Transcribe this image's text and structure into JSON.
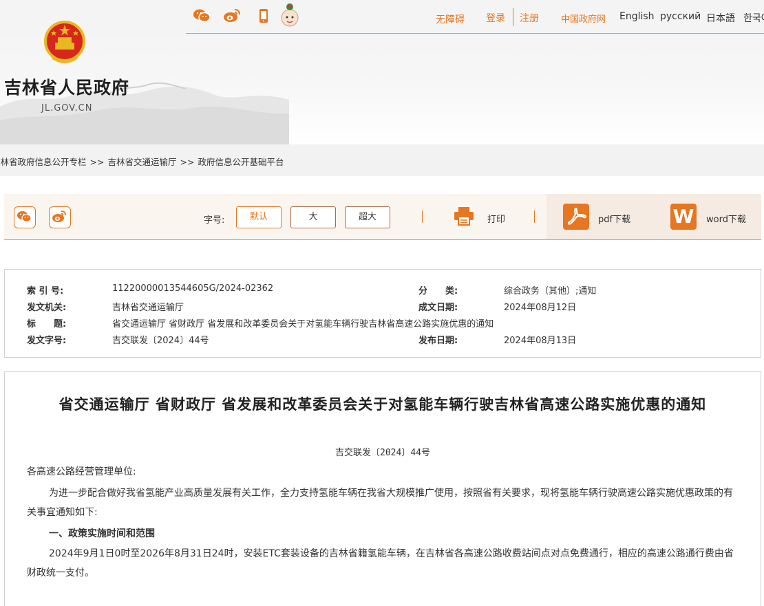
{
  "header": {
    "site_name": "吉林省人民政府",
    "site_domain": "JL.GOV.CN"
  },
  "topbar": {
    "icons": [
      "wechat-icon",
      "weibo-icon",
      "mobile-icon",
      "mascot-icon"
    ],
    "accessibility": "无障碍",
    "login": "登录",
    "register": "注册",
    "gov_cn": "中国政府网",
    "english": "English",
    "russian": "русский",
    "japanese": "日本語",
    "korean": "한국어"
  },
  "breadcrumb": {
    "items": [
      "吉林省政府信息公开专栏",
      "吉林省交通运输厅",
      "政府信息公开基础平台"
    ],
    "separator": ">>"
  },
  "toolbar": {
    "font_size_label": "字号:",
    "font_default": "默认",
    "font_large": "大",
    "font_xlarge": "超大",
    "print": "打印",
    "pdf": "pdf下载",
    "word": "word下载",
    "word_letter": "W"
  },
  "meta": {
    "index_label": "索 引 号:",
    "index_value": "11220000013544605G/2024-02362",
    "category_label": "分　　类:",
    "category_value": "综合政务（其他）;通知",
    "issuer_label": "发文机关:",
    "issuer_value": "吉林省交通运输厅",
    "created_label": "成文日期:",
    "created_value": "2024年08月12日",
    "title_label": "标　　题:",
    "title_value": "省交通运输厅 省财政厅 省发展和改革委员会关于对氢能车辆行驶吉林省高速公路实施优惠的通知",
    "docno_label": "发文字号:",
    "docno_value": "吉交联发〔2024〕44号",
    "published_label": "发布日期:",
    "published_value": "2024年08月13日"
  },
  "document": {
    "title": "省交通运输厅 省财政厅 省发展和改革委员会关于对氢能车辆行驶吉林省高速公路实施优惠的通知",
    "number": "吉交联发〔2024〕44号",
    "salutation": "各高速公路经营管理单位:",
    "intro": "为进一步配合做好我省氢能产业高质量发展有关工作，全力支持氢能车辆在我省大规模推广使用，按照省有关要求，现将氢能车辆行驶高速公路实施优惠政策的有关事宜通知如下:",
    "section1_heading": "一、政策实施时间和范围",
    "section1_body": "2024年9月1日0时至2026年8月31日24时，安装ETC套装设备的吉林省籍氢能车辆，在吉林省各高速公路收费站间点对点免费通行，相应的高速公路通行费由省财政统一支付。"
  },
  "colors": {
    "accent": "#e6761f",
    "button_border": "#a86a46",
    "breadcrumb_bg": "#f2f2f2",
    "toolbar_bg": "#fbf5ef"
  }
}
